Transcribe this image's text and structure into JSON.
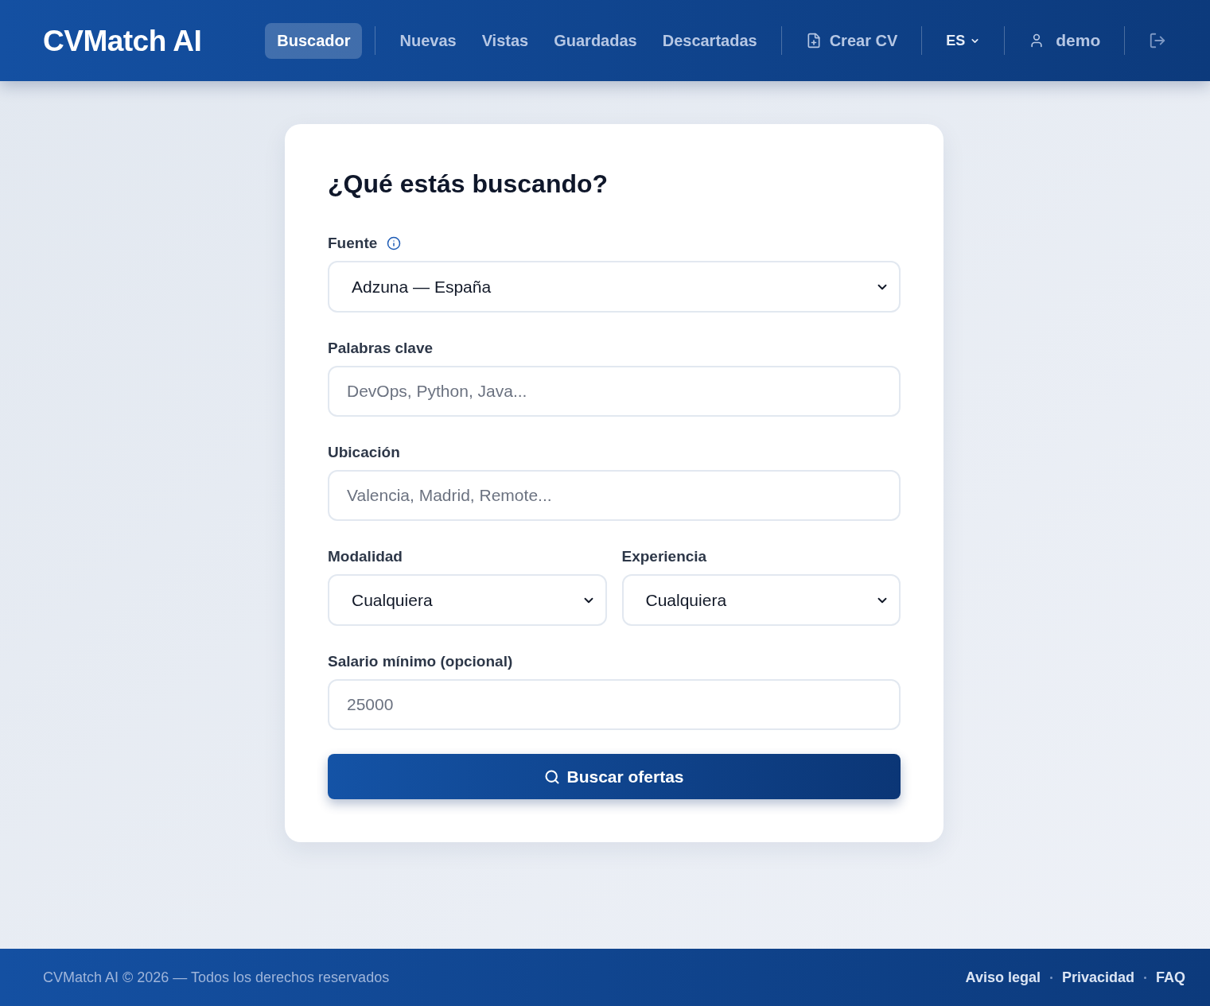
{
  "header": {
    "logo": "CVMatch AI",
    "nav": [
      {
        "label": "Buscador",
        "selected": true
      },
      {
        "label": "Nuevas",
        "selected": false
      },
      {
        "label": "Vistas",
        "selected": false
      },
      {
        "label": "Guardadas",
        "selected": false
      },
      {
        "label": "Descartadas",
        "selected": false
      }
    ],
    "create_cv": "Crear CV",
    "language": "ES",
    "user": "demo"
  },
  "form": {
    "title": "¿Qué estás buscando?",
    "fields": [
      {
        "kind": "select",
        "label": "Fuente",
        "info_icon": true,
        "value": "Adzuna — España"
      },
      {
        "kind": "text",
        "label": "Palabras clave",
        "placeholder": "DevOps, Python, Java..."
      },
      {
        "kind": "text",
        "label": "Ubicación",
        "placeholder": "Valencia, Madrid, Remote..."
      },
      {
        "kind": "pair",
        "fields": [
          {
            "kind": "select",
            "label": "Modalidad",
            "value": "Cualquiera"
          },
          {
            "kind": "select",
            "label": "Experiencia",
            "value": "Cualquiera"
          }
        ]
      },
      {
        "kind": "text",
        "label": "Salario mínimo (opcional)",
        "placeholder": "25000"
      }
    ],
    "submit": "Buscar ofertas"
  },
  "footer": {
    "copyright": "CVMatch AI © 2026 — Todos los derechos reservados",
    "links": [
      "Aviso legal",
      "Privacidad",
      "FAQ"
    ]
  }
}
